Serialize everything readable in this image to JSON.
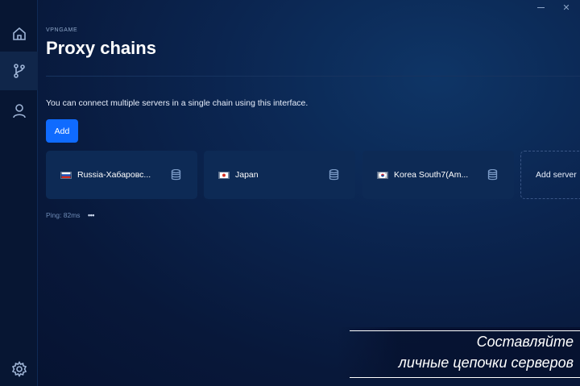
{
  "window": {
    "minimize_icon": "minimize-icon",
    "close_label": "✕"
  },
  "sidebar": {
    "items": [
      {
        "name": "home",
        "icon": "home-icon"
      },
      {
        "name": "proxy-chains",
        "icon": "branch-icon",
        "active": true
      },
      {
        "name": "account",
        "icon": "user-icon"
      },
      {
        "name": "settings",
        "icon": "gear-icon"
      }
    ]
  },
  "header": {
    "brand": "VPNGAME",
    "title": "Proxy chains"
  },
  "main": {
    "description": "You can connect multiple servers in a single chain using this interface.",
    "add_label": "Add",
    "chain": [
      {
        "label": "Russia-Хабаровс...",
        "flag": "ru",
        "icon": "database-icon"
      },
      {
        "label": "Japan",
        "flag": "jp",
        "icon": "database-icon"
      },
      {
        "label": "Korea South7(Am...",
        "flag": "kr",
        "icon": "database-icon"
      }
    ],
    "add_server_label": "Add server",
    "ping": "Ping: 82ms",
    "more": "•••"
  },
  "promo": {
    "line1": "Составляйте",
    "line2": "личные цепочки серверов"
  },
  "colors": {
    "accent": "#0f6bff",
    "card": "#0d2a55",
    "sidebar": "#071633"
  }
}
